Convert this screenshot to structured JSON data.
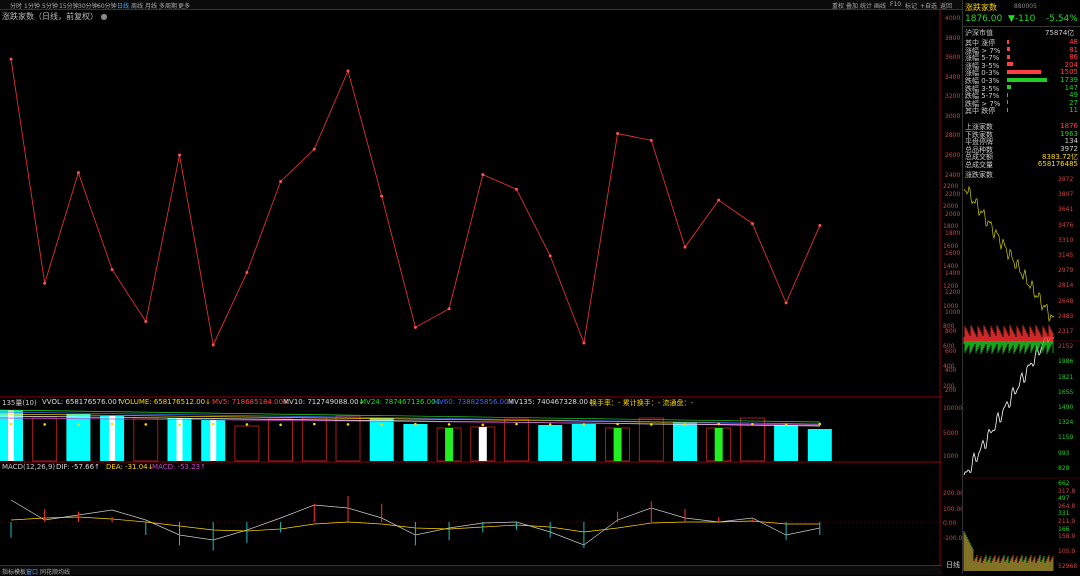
{
  "toolbar": {
    "periods": [
      "分时",
      "1分钟",
      "5分钟",
      "15分钟",
      "30分钟",
      "60分钟",
      "日线",
      "周线",
      "月线",
      "多周期",
      "更多"
    ],
    "right_items": [
      "重权",
      "叠加",
      "统计",
      "画线",
      "F10",
      "标记",
      "+自选",
      "返回"
    ]
  },
  "chart": {
    "title": "涨跌家数（日线，前复权）",
    "y_axis_ticks": [
      "4000",
      "3800",
      "3600",
      "3400",
      "3200",
      "3000",
      "2800",
      "2600",
      "2400",
      "2200",
      "2000",
      "1800",
      "1600",
      "1400",
      "1200",
      "1000",
      "800",
      "600",
      "400",
      "200"
    ]
  },
  "chart_data": [
    {
      "type": "line",
      "title": "涨跌家数（日线，前复权）",
      "color": "#e03030",
      "x": [
        1,
        2,
        3,
        4,
        5,
        6,
        7,
        8,
        9,
        10,
        11,
        12,
        13,
        14,
        15,
        16,
        17,
        18,
        19,
        20,
        21,
        22,
        23,
        24,
        25
      ],
      "values": [
        3580,
        1290,
        2420,
        1430,
        900,
        2600,
        660,
        1400,
        2330,
        2660,
        3460,
        2180,
        840,
        1030,
        2400,
        2250,
        1570,
        680,
        2820,
        2750,
        1660,
        2140,
        1900,
        1090,
        1880
      ],
      "ylim": [
        200,
        4000
      ]
    },
    {
      "type": "bar",
      "title": "135量(10)",
      "series": [
        {
          "name": "VVOL",
          "values": []
        }
      ]
    }
  ],
  "indicator1": {
    "label": "135量(10)",
    "vvol": "VVOL: 658176576.00↑",
    "volume": "VOLUME: 658176512.00↓",
    "mv5": "MV5: 718685184.00↓",
    "mv10": "MV10: 712749088.00↓",
    "mv24": "MV24: 787467136.00↓",
    "mv60": "MV60: 738825856.00↓",
    "mv135": "MV135: 740467328.00↓",
    "extra": "换手率：- 累计换手：- 流通盘：-",
    "y_ticks": [
      "10000",
      "5000",
      "1000"
    ]
  },
  "indicator2": {
    "label": "MACD(12,26,9)",
    "dif": "DIF: -57.66↑",
    "dea": "DEA: -31.04↓",
    "macd": "MACD: -53.23↑",
    "y_ticks": [
      "200.00",
      "100.00",
      "0.00",
      "-100.00"
    ]
  },
  "bottom_tabs": [
    "指标",
    "模板",
    "窗口",
    "同花顺",
    "均线"
  ],
  "right_panel": {
    "title": "涨跌家数",
    "code": "880005",
    "price": "1876.00",
    "change": "▼-110",
    "change_pct": "-5.54%",
    "market_label": "沪深市值",
    "market_value": "75874亿",
    "rows": [
      {
        "label": "其中 涨停",
        "value": "48",
        "color": "#ff4040",
        "bar": 2
      },
      {
        "label": "涨幅 > 7%",
        "value": "81",
        "color": "#ff4040",
        "bar": 3
      },
      {
        "label": "涨幅 5-7%",
        "value": "86",
        "color": "#ff4040",
        "bar": 3
      },
      {
        "label": "涨幅 3-5%",
        "value": "204",
        "color": "#ff4040",
        "bar": 6
      },
      {
        "label": "涨幅 0-3%",
        "value": "1505",
        "color": "#ff4040",
        "bar": 34
      },
      {
        "label": "跌幅 0-3%",
        "value": "1739",
        "color": "#22cc22",
        "bar": 40
      },
      {
        "label": "跌幅 3-5%",
        "value": "147",
        "color": "#22cc22",
        "bar": 4
      },
      {
        "label": "跌幅 5-7%",
        "value": "49",
        "color": "#22cc22",
        "bar": 1
      },
      {
        "label": "跌幅 > 7%",
        "value": "27",
        "color": "#22cc22",
        "bar": 1
      },
      {
        "label": "其中 跌停",
        "value": "11",
        "color": "#22cc22",
        "bar": 1
      }
    ],
    "stats": [
      {
        "label": "上涨家数",
        "value": "1876",
        "color": "#ff4040"
      },
      {
        "label": "下跌家数",
        "value": "1963",
        "color": "#22cc22"
      },
      {
        "label": "平盘停牌",
        "value": "134",
        "color": "#ccc"
      },
      {
        "label": "总品种数",
        "value": "3972",
        "color": "#ccc"
      },
      {
        "label": "总成交额",
        "value": "8383.72亿",
        "color": "#ffd700"
      },
      {
        "label": "总成交量",
        "value": "658176485",
        "color": "#ffd700"
      }
    ],
    "mini_title": "涨跌家数",
    "mini_left_ticks": [
      "2200",
      "2000",
      "1800",
      "1600",
      "1400",
      "1200",
      "1000",
      "800",
      "600",
      "400",
      "200"
    ],
    "mini_right_ticks": [
      "3972",
      "3807",
      "3641",
      "3476",
      "3310",
      "3145",
      "2979",
      "2814",
      "2648",
      "2483",
      "2317",
      "2152",
      "1986",
      "1821",
      "1655",
      "1490",
      "1324",
      "1159",
      "993",
      "828",
      "662",
      "497",
      "331",
      "166"
    ],
    "vol_ticks": [
      "317.8",
      "264.8",
      "211.9",
      "158.9",
      "105.9",
      "52968"
    ],
    "vol_left_ticks": [
      "300.",
      "200.",
      "100."
    ],
    "mini_label": "日线"
  }
}
